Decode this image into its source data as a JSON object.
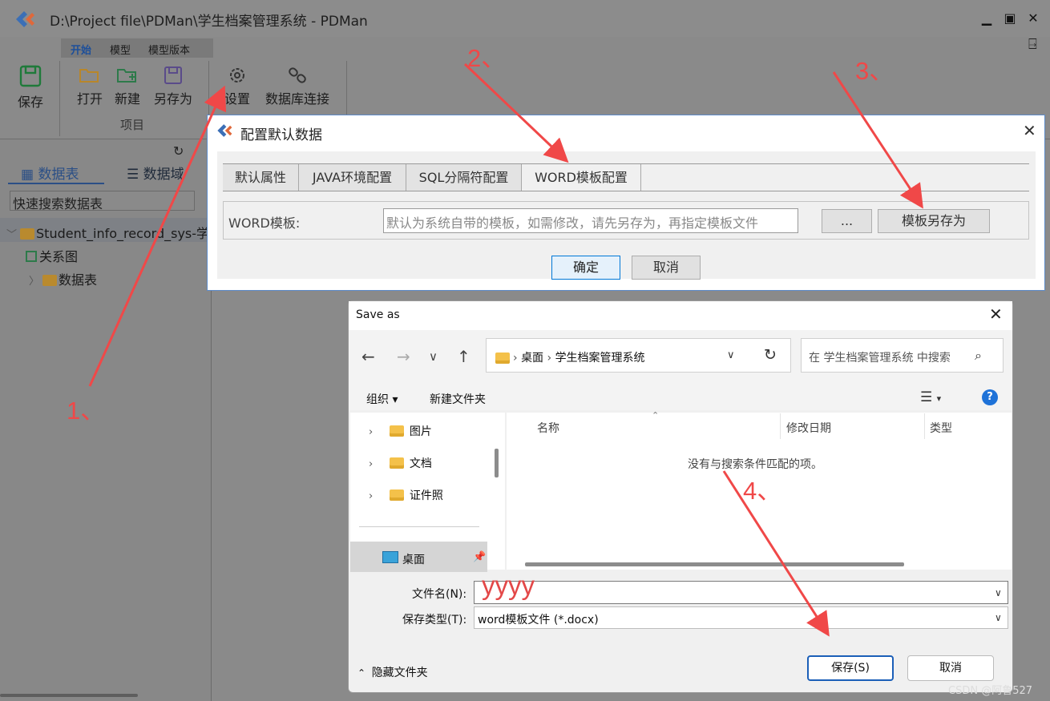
{
  "app": {
    "title": "D:\\Project file\\PDMan\\学生档案管理系统 - PDMan",
    "window_controls": [
      "minimize",
      "maximize",
      "close"
    ],
    "ribbon_tabs": [
      "开始",
      "模型",
      "模型版本"
    ],
    "ribbon_buttons": {
      "save": "保存",
      "open": "打开",
      "new": "新建",
      "save_as": "另存为",
      "settings": "设置",
      "db_connect": "数据库连接"
    },
    "group_label": "项目",
    "sidebar": {
      "tabs": [
        "数据表",
        "数据域"
      ],
      "search_placeholder": "快速搜索数据表",
      "tree": [
        "Student_info_record_sys-学",
        "关系图",
        "数据表"
      ]
    }
  },
  "config_dialog": {
    "title": "配置默认数据",
    "tabs": [
      "默认属性",
      "JAVA环境配置",
      "SQL分隔符配置",
      "WORD模板配置"
    ],
    "active_tab": "WORD模板配置",
    "word_label": "WORD模板:",
    "word_placeholder": "默认为系统自带的模板，如需修改，请先另存为，再指定模板文件",
    "browse_label": "...",
    "save_template_label": "模板另存为",
    "ok_label": "确定",
    "cancel_label": "取消"
  },
  "save_dialog": {
    "title": "Save as",
    "breadcrumb": [
      "桌面",
      "学生档案管理系统"
    ],
    "search_placeholder": "在 学生档案管理系统 中搜索",
    "toolbar": {
      "organize": "组织 ▾",
      "new_folder": "新建文件夹"
    },
    "nav_items": [
      "图片",
      "文档",
      "证件照"
    ],
    "pinned": "桌面",
    "columns": [
      "名称",
      "修改日期",
      "类型"
    ],
    "empty_message": "没有与搜索条件匹配的项。",
    "filename_label": "文件名(N):",
    "filename_value": "yyyy",
    "filetype_label": "保存类型(T):",
    "filetype_value": "word模板文件 (*.docx)",
    "hide_folders": "隐藏文件夹",
    "save_label": "保存(S)",
    "cancel_label": "取消"
  },
  "annotations": [
    "1、",
    "2、",
    "3、",
    "4、"
  ],
  "watermark": "CSDN @阿鲁527",
  "colors": {
    "annotation": "#f04848",
    "accent": "#0078d7"
  }
}
